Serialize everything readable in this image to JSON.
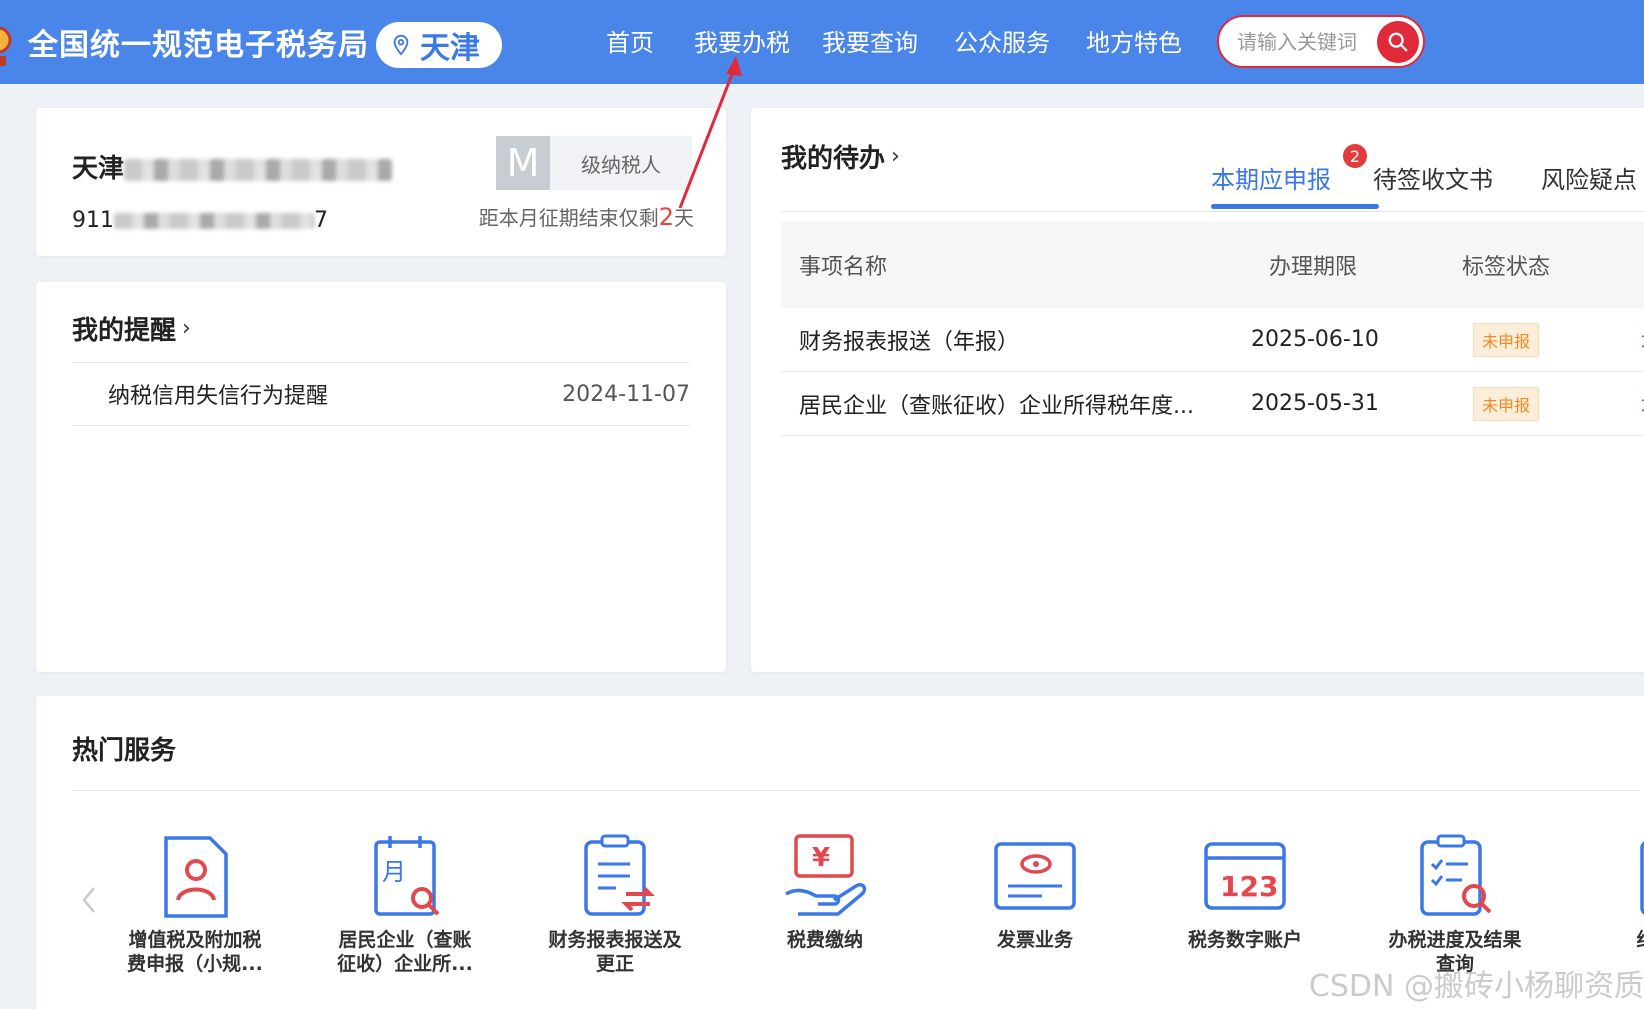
{
  "header": {
    "site_title": "全国统一规范电子税务局",
    "region": "天津",
    "nav": [
      "首页",
      "我要办税",
      "我要查询",
      "公众服务",
      "地方特色"
    ],
    "search_placeholder": "请输入关键词"
  },
  "taxpayer": {
    "name_prefix": "天津",
    "id_prefix": "911",
    "id_suffix": "7",
    "level_letter": "M",
    "level_label": "级纳税人",
    "deadline_prefix": "距本月征期结束仅剩",
    "deadline_days": "2",
    "deadline_suffix": "天"
  },
  "reminders": {
    "title": "我的提醒",
    "items": [
      {
        "text": "纳税信用失信行为提醒",
        "date": "2024-11-07"
      }
    ]
  },
  "todo": {
    "title": "我的待办",
    "tabs": [
      "本期应申报",
      "待签收文书",
      "风险疑点"
    ],
    "active_badge": "2",
    "columns": [
      "事项名称",
      "办理期限",
      "标签状态"
    ],
    "rows": [
      {
        "name": "财务报表报送（年报）",
        "date": "2025-06-10",
        "status": "未申报",
        "op": "填"
      },
      {
        "name": "居民企业（查账征收）企业所得税年度...",
        "date": "2025-05-31",
        "status": "未申报",
        "op": "填"
      }
    ]
  },
  "hot_services": {
    "title": "热门服务",
    "items": [
      "增值税及附加税\n费申报（小规...",
      "居民企业（查账\n征收）企业所...",
      "财务报表报送及\n更正",
      "税费缴纳",
      "发票业务",
      "税务数字账户",
      "办税进度及结果\n查询",
      "红字发"
    ]
  },
  "watermark": "CSDN @搬砖小杨聊资质",
  "colors": {
    "header_blue": "#4a86ea",
    "accent_blue": "#3b78e7",
    "search_red": "#e02a3a",
    "status_orange": "#f08a24"
  }
}
